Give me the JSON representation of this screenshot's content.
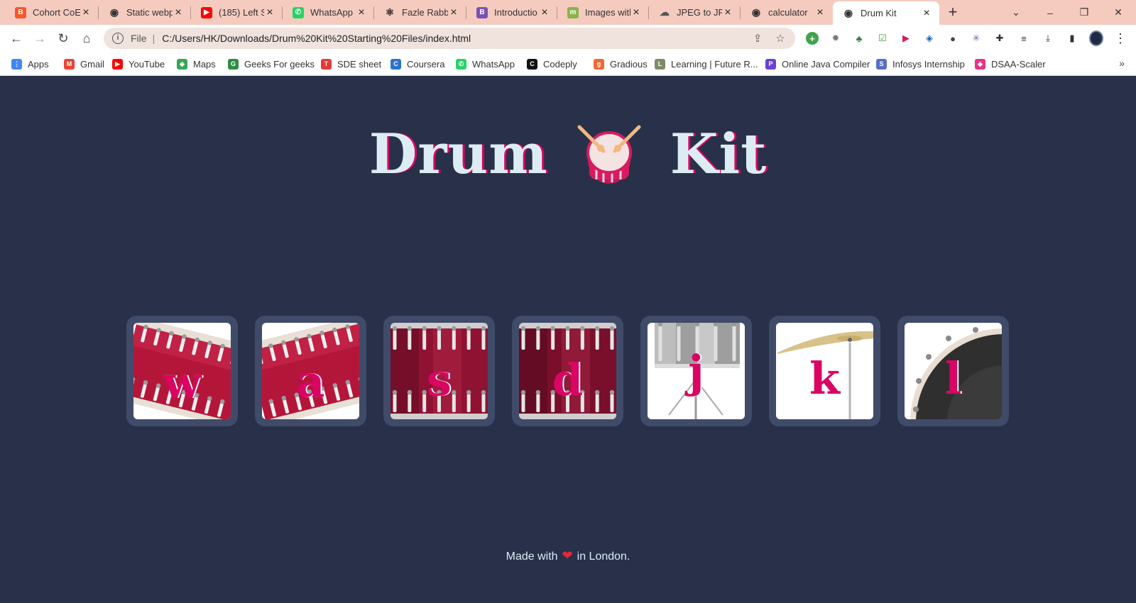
{
  "tabs": [
    {
      "title": "Cohort CoE",
      "favicon": "brave-icon",
      "color": "#fb542b"
    },
    {
      "title": "Static webp",
      "favicon": "globe-icon",
      "color": "#333333"
    },
    {
      "title": "(185) Left S",
      "favicon": "youtube-icon",
      "color": "#ff0000"
    },
    {
      "title": "WhatsApp",
      "favicon": "whatsapp-icon",
      "color": "#25d366"
    },
    {
      "title": "Fazle Rabby",
      "favicon": "react-icon",
      "color": "#222222"
    },
    {
      "title": "Introductio",
      "favicon": "bootstrap-icon",
      "color": "#7952b3"
    },
    {
      "title": "Images with",
      "favicon": "m-icon",
      "color": "#8bb34a"
    },
    {
      "title": "JPEG to JPG",
      "favicon": "cloud-icon",
      "color": "#555555"
    },
    {
      "title": "calculator",
      "favicon": "globe-icon",
      "color": "#333333"
    },
    {
      "title": "Drum Kit",
      "favicon": "globe-icon",
      "color": "#333333",
      "active": true
    }
  ],
  "omnibox": {
    "scheme_label": "File",
    "url": "C:/Users/HK/Downloads/Drum%20Kit%20Starting%20Files/index.html"
  },
  "bookmarks": [
    {
      "label": "Apps",
      "icon": "apps-grid-icon",
      "color": "#4285f4"
    },
    {
      "label": "Gmail",
      "icon": "gmail-icon",
      "color": "#ea4335"
    },
    {
      "label": "YouTube",
      "icon": "youtube-icon",
      "color": "#ff0000"
    },
    {
      "label": "Maps",
      "icon": "maps-icon",
      "color": "#34a853"
    },
    {
      "label": "Geeks For geeks",
      "icon": "gfg-icon",
      "color": "#2f8d46"
    },
    {
      "label": "SDE sheet",
      "icon": "tuf-icon",
      "color": "#e53935"
    },
    {
      "label": "Coursera",
      "icon": "coursera-icon",
      "color": "#2a73cc"
    },
    {
      "label": "WhatsApp",
      "icon": "whatsapp-icon",
      "color": "#25d366"
    },
    {
      "label": "Codeply",
      "icon": "codeply-icon",
      "color": "#111111"
    },
    {
      "label": "Gradious",
      "icon": "gradious-icon",
      "color": "#f06a35"
    },
    {
      "label": "Learning | Future R...",
      "icon": "learning-icon",
      "color": "#7d8b6a"
    },
    {
      "label": "Online Java Compiler",
      "icon": "programiz-icon",
      "color": "#6c3fd6"
    },
    {
      "label": "Infosys Internship",
      "icon": "infosys-icon",
      "color": "#5a6fc4"
    },
    {
      "label": "DSAA-Scaler",
      "icon": "scaler-icon",
      "color": "#e8308a"
    }
  ],
  "page": {
    "title_left": "Drum",
    "title_right": "Kit",
    "drums": [
      {
        "key": "w",
        "kind": "tom-tilted",
        "label": "tom-1"
      },
      {
        "key": "a",
        "kind": "tom-tilted-2",
        "label": "tom-2"
      },
      {
        "key": "s",
        "kind": "tom-front",
        "label": "tom-3"
      },
      {
        "key": "d",
        "kind": "tom-front-dark",
        "label": "tom-4"
      },
      {
        "key": "j",
        "kind": "snare",
        "label": "snare"
      },
      {
        "key": "k",
        "kind": "crash",
        "label": "crash"
      },
      {
        "key": "l",
        "kind": "kick",
        "label": "kick"
      }
    ],
    "footer": {
      "before": "Made with",
      "after": "in London."
    }
  },
  "colors": {
    "background": "#283149",
    "card": "#404b69",
    "title_text": "#dbedf3",
    "accent": "#da0463"
  }
}
